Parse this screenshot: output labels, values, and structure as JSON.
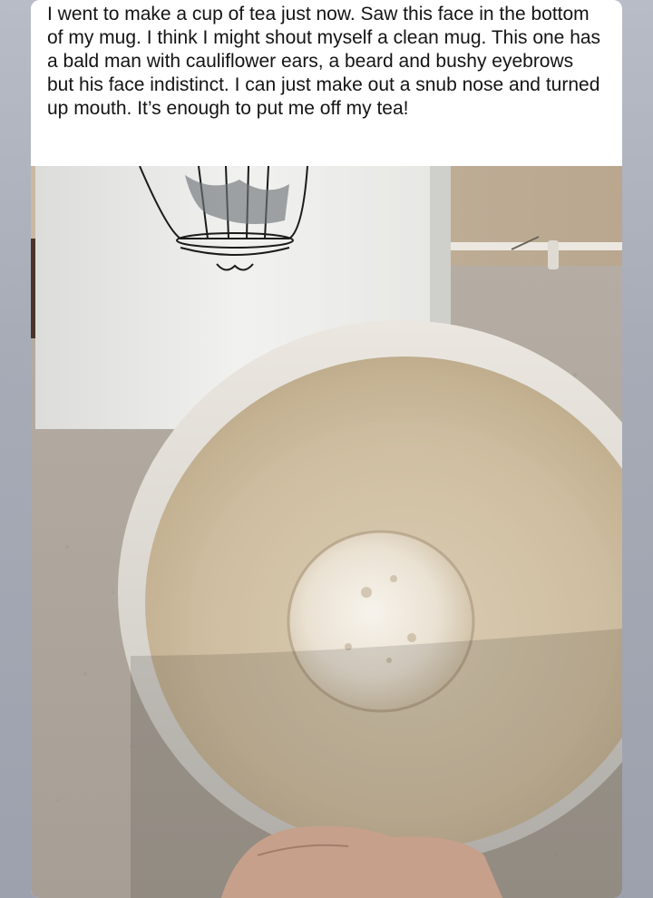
{
  "post": {
    "caption": "I went to make a cup of tea just now.  Saw this face in the bottom of my mug.  I think I might shout myself a clean mug.  This one has a bald man with cauliflower ears, a beard and bushy eyebrows but his face indistinct.  I can just make out a snub nose and turned up mouth.  It’s enough to put me off my tea!"
  },
  "colors": {
    "page_background": "#a9adb8",
    "card_background": "#ffffff",
    "text": "#141414"
  }
}
